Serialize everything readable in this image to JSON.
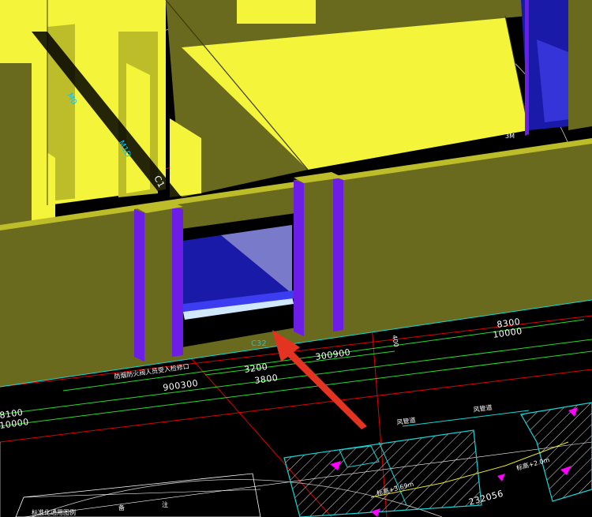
{
  "colors": {
    "background": "#000000",
    "wall_top": "#f4f53a",
    "wall_face": "#6a6a1e",
    "wall_side": "#bdbd2a",
    "column": "#6d1ee6",
    "window_glass": "#1a1aa8",
    "red_line": "#e00000",
    "green_line": "#22dd22",
    "cyan_line": "#14d9d9",
    "magenta": "#ff00ff",
    "arrow": "#e53322"
  },
  "labels": {
    "window_tag": "C32",
    "mark_400": "400",
    "mark_3m": "3M",
    "mark_m0": "M0",
    "mark_c4": "M1D",
    "mark_c5": "C1"
  },
  "dimensions": {
    "d_8300": "8300",
    "d_10000_right": "10000",
    "d_300_900_right": "300900",
    "d_3200": "3200",
    "d_3800": "3800",
    "d_900_300_left": "900300",
    "d_8100": "8100",
    "d_10000_left": "10000"
  },
  "annotations": {
    "note_left": "防烟防火阀人员受入检修口",
    "note_right_a": "风管道",
    "note_right_b": "风管道",
    "elev_a": "标高+2.0m",
    "elev_b": "标高+3.69m",
    "code": "232056",
    "table_title": "标准化通用图例",
    "table_col1": "备",
    "table_col2": "注"
  }
}
